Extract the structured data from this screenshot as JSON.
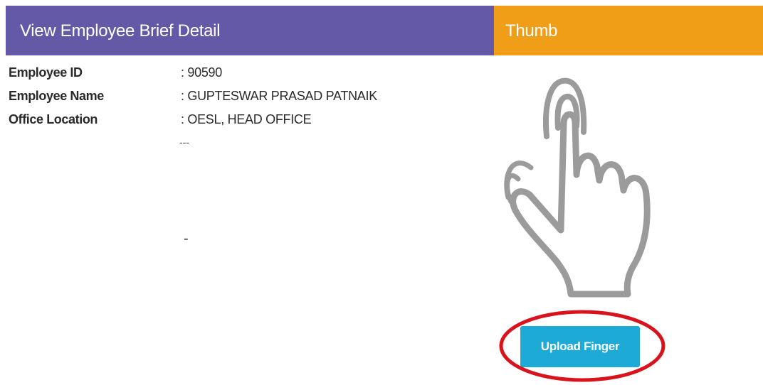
{
  "header": {
    "title": "View Employee Brief Detail",
    "thumb_title": "Thumb",
    "colors": {
      "left_bg": "#6459a6",
      "right_bg": "#f09e17"
    }
  },
  "details": [
    {
      "label": "Employee ID",
      "value": ": 90590"
    },
    {
      "label": "Employee Name",
      "value": ": GUPTESWAR PRASAD PATNAIK"
    },
    {
      "label": "Office Location",
      "value": ": OESL, HEAD OFFICE"
    }
  ],
  "placeholders": {
    "dash_a": "---",
    "dash_b": "-"
  },
  "thumb": {
    "icon": "hand-pointer-icon",
    "upload_label": "Upload Finger",
    "button_color": "#1eaad6",
    "highlight_color": "#d8131b"
  }
}
